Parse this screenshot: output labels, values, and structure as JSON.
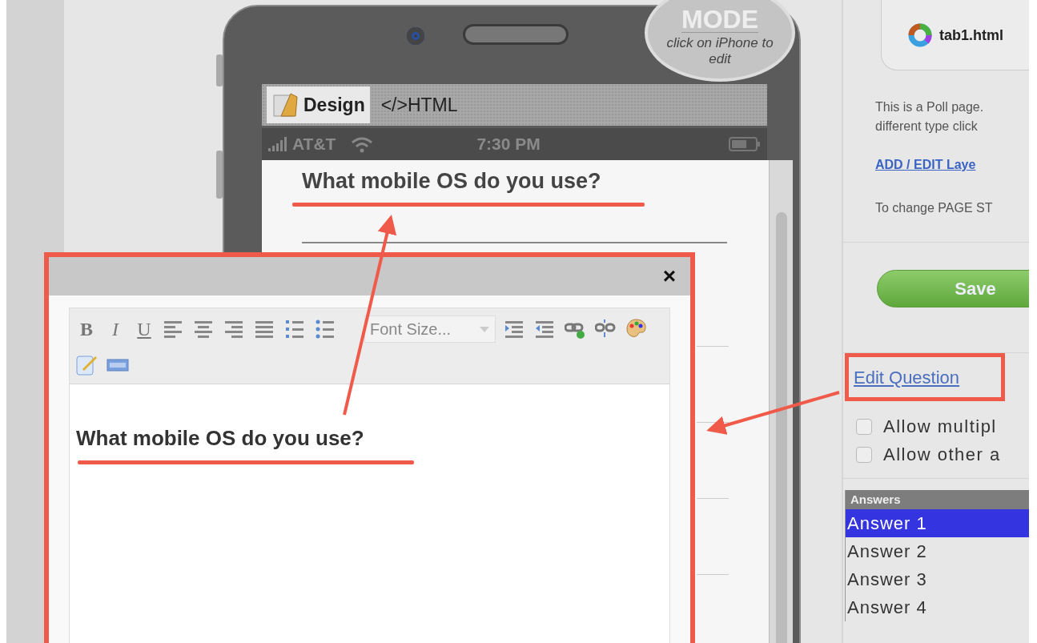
{
  "phone": {
    "mode_badge": {
      "title": "MODE",
      "hint": "click on iPhone to edit"
    },
    "tabs": [
      {
        "label": "Design",
        "selected": true
      },
      {
        "label": "</>HTML",
        "selected": false
      }
    ],
    "status_bar": {
      "carrier": "AT&T",
      "time": "7:30 PM"
    },
    "question": "What mobile OS do you use?"
  },
  "editor_dialog": {
    "close": "×",
    "toolbar": [
      {
        "kind": "bold",
        "label": "B"
      },
      {
        "kind": "italic",
        "label": "I"
      },
      {
        "kind": "underline",
        "label": "U"
      },
      {
        "kind": "align-left"
      },
      {
        "kind": "align-center"
      },
      {
        "kind": "align-right"
      },
      {
        "kind": "justify"
      },
      {
        "kind": "ordered-list"
      },
      {
        "kind": "bullet-list"
      },
      {
        "kind": "select",
        "placeholder": "Font Size..."
      },
      {
        "kind": "indent"
      },
      {
        "kind": "outdent"
      },
      {
        "kind": "link"
      },
      {
        "kind": "unlink"
      },
      {
        "kind": "palette"
      },
      {
        "kind": "break"
      },
      {
        "kind": "edit"
      },
      {
        "kind": "html"
      }
    ],
    "content": "What mobile OS do you use?"
  },
  "sidebar": {
    "file": "tab1.html",
    "info_lines": [
      "This is a Poll page.",
      "different type click"
    ],
    "layers_link": "ADD / EDIT Laye",
    "style_text": "To change PAGE ST",
    "save": "Save",
    "edit_question": "Edit Question",
    "options": [
      {
        "label": "Allow multipl",
        "checked": false
      },
      {
        "label": "Allow other a",
        "checked": false
      }
    ],
    "answers": {
      "header": "Answers",
      "items": [
        {
          "label": "Answer 1",
          "selected": true
        },
        {
          "label": "Answer 2",
          "selected": false
        },
        {
          "label": "Answer 3",
          "selected": false
        },
        {
          "label": "Answer 4",
          "selected": false
        }
      ]
    }
  }
}
